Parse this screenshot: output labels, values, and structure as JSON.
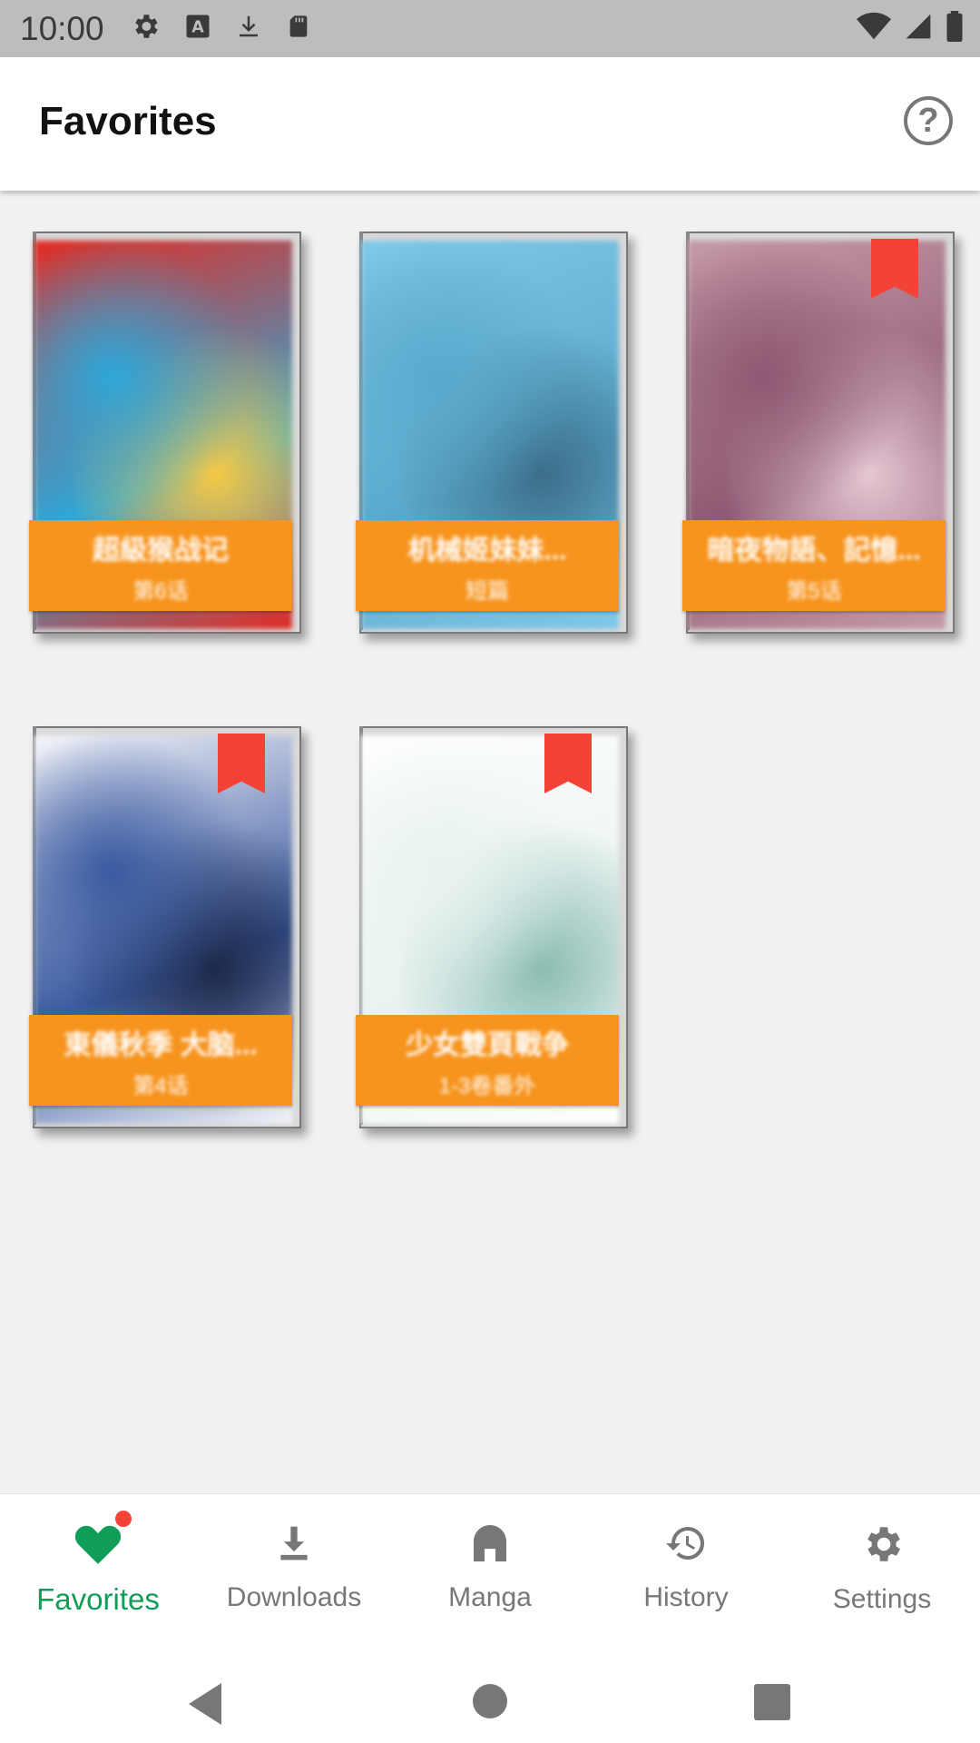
{
  "status_bar": {
    "time": "10:00",
    "left_icons": [
      "gear-icon",
      "a-icon",
      "download-icon",
      "sd-card-icon"
    ],
    "right_icons": [
      "wifi-icon",
      "signal-icon",
      "battery-icon"
    ]
  },
  "app_bar": {
    "title": "Favorites",
    "help_glyph": "?"
  },
  "favorites": [
    {
      "title": "超級猴战记",
      "subtitle": "第6话",
      "bookmarked": false,
      "colors": [
        "#e32b22",
        "#2ea7d8",
        "#f7c843"
      ]
    },
    {
      "title": "机械姬妹妹...",
      "subtitle": "短篇",
      "bookmarked": false,
      "colors": [
        "#7fc8e8",
        "#5aa9cc",
        "#3c6e8a"
      ]
    },
    {
      "title": "暗夜物語、記憶...",
      "subtitle": "第5话",
      "bookmarked": true,
      "colors": [
        "#c69aa8",
        "#8e5a73",
        "#e6c8d4"
      ]
    },
    {
      "title": "東儀秋季 大脑...",
      "subtitle": "第4话",
      "bookmarked": true,
      "colors": [
        "#f5f5fa",
        "#3a5aa0",
        "#1e2a4a"
      ]
    },
    {
      "title": "少女雙頁戰争",
      "subtitle": "1-3卷番外",
      "bookmarked": true,
      "colors": [
        "#ffffff",
        "#e8f2f0",
        "#8bbcb2"
      ]
    }
  ],
  "bottom_nav": [
    {
      "label": "Favorites",
      "icon": "heart-icon",
      "active": true,
      "badge": true
    },
    {
      "label": "Downloads",
      "icon": "download-icon",
      "active": false
    },
    {
      "label": "Manga",
      "icon": "home-icon",
      "active": false
    },
    {
      "label": "History",
      "icon": "history-icon",
      "active": false
    },
    {
      "label": "Settings",
      "icon": "gear-icon",
      "active": false
    }
  ],
  "colors": {
    "accent": "#109d58",
    "label_bg": "#f7941d",
    "bookmark": "#f44336"
  }
}
